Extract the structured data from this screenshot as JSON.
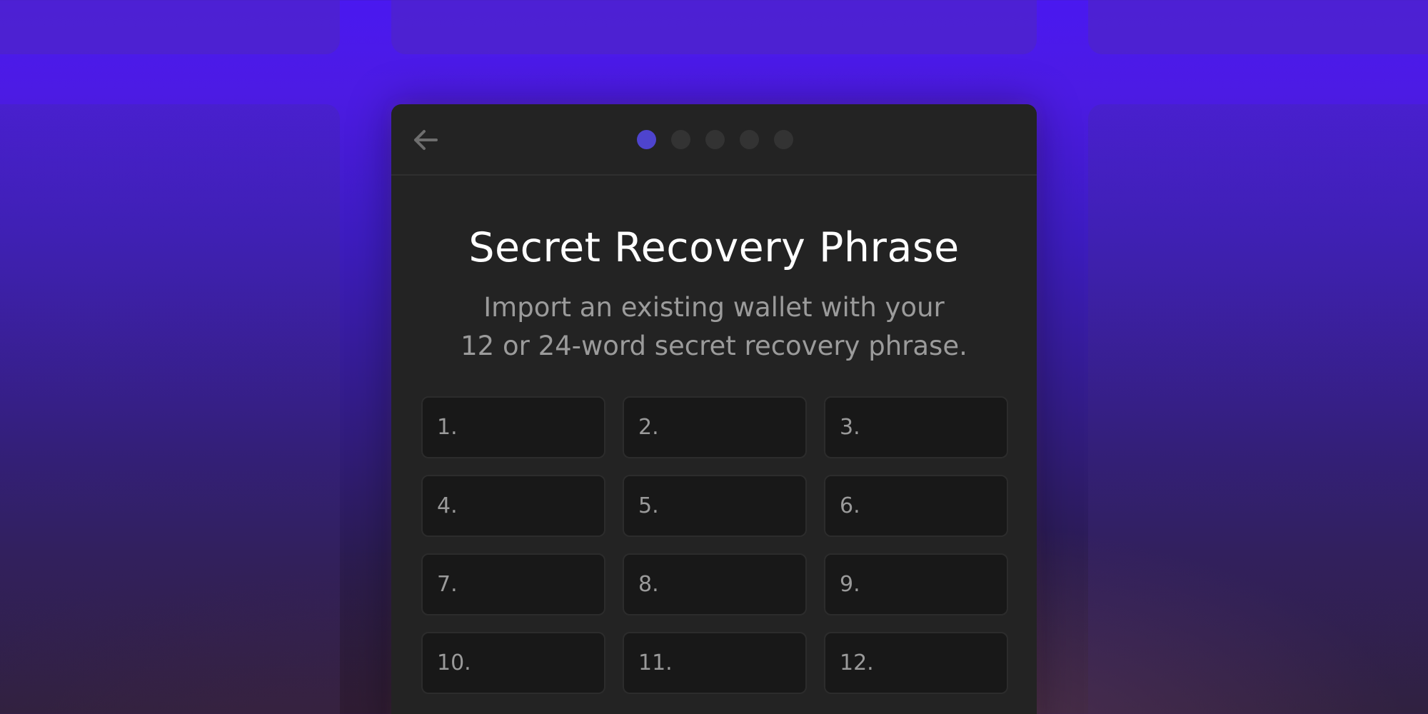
{
  "header": {
    "back_icon": "arrow-left-icon",
    "steps": {
      "total": 5,
      "current": 1
    }
  },
  "main": {
    "title": "Secret Recovery Phrase",
    "subtitle_line1": "Import an existing wallet with your",
    "subtitle_line2": "12 or 24-word secret recovery phrase."
  },
  "words": [
    {
      "label": "1.",
      "value": ""
    },
    {
      "label": "2.",
      "value": ""
    },
    {
      "label": "3.",
      "value": ""
    },
    {
      "label": "4.",
      "value": ""
    },
    {
      "label": "5.",
      "value": ""
    },
    {
      "label": "6.",
      "value": ""
    },
    {
      "label": "7.",
      "value": ""
    },
    {
      "label": "8.",
      "value": ""
    },
    {
      "label": "9.",
      "value": ""
    },
    {
      "label": "10.",
      "value": ""
    },
    {
      "label": "11.",
      "value": ""
    },
    {
      "label": "12.",
      "value": ""
    }
  ],
  "colors": {
    "accent": "#4e44ce",
    "panel": "#232323",
    "field": "#181818",
    "background_top": "#4a18f0"
  }
}
